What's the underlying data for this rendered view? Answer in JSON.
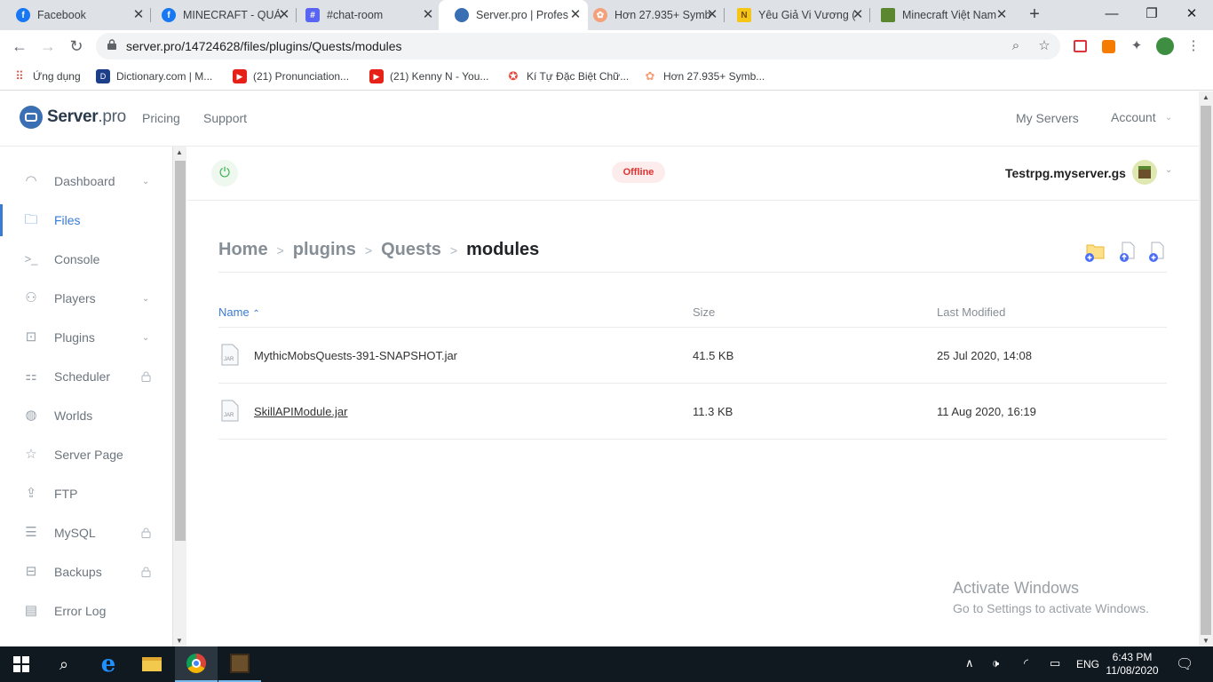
{
  "browser": {
    "tabs": [
      {
        "title": "Facebook",
        "favicon": "facebook-icon",
        "color": "#1877f2",
        "glyph": "f"
      },
      {
        "title": "MINECRAFT - QUẢ",
        "favicon": "facebook-icon",
        "color": "#1877f2",
        "glyph": "f"
      },
      {
        "title": "#chat-room",
        "favicon": "chat-icon",
        "color": "#5865f2",
        "glyph": "#"
      },
      {
        "title": "Server.pro | Profes",
        "favicon": "serverpro-icon",
        "color": "#3a6fb3",
        "glyph": ""
      },
      {
        "title": "Hơn 27.935+ Symb",
        "favicon": "symbol-icon",
        "color": "#f4a07a",
        "glyph": "✿"
      },
      {
        "title": "Yêu Giả Vi Vương (",
        "favicon": "n-icon",
        "color": "#f5c518",
        "glyph": "N"
      },
      {
        "title": "Minecraft Việt Nam",
        "favicon": "minecraft-icon",
        "color": "#5b8731",
        "glyph": ""
      }
    ],
    "url": "server.pro/14724628/files/plugins/Quests/modules",
    "bookmarks": [
      {
        "label": "Ứng dụng",
        "icon": "apps-icon"
      },
      {
        "label": "Dictionary.com | M...",
        "icon": "dictionary-icon"
      },
      {
        "label": "(21) Pronunciation...",
        "icon": "youtube-icon"
      },
      {
        "label": "(21) Kenny N - You...",
        "icon": "youtube-icon"
      },
      {
        "label": "Kí Tự Đặc Biệt Chữ...",
        "icon": "symbol-icon"
      },
      {
        "label": "Hơn 27.935+ Symb...",
        "icon": "symbol-icon"
      }
    ]
  },
  "site": {
    "logo_main": "Server",
    "logo_suffix": ".pro",
    "nav": {
      "pricing": "Pricing",
      "support": "Support",
      "my_servers": "My Servers",
      "account": "Account"
    }
  },
  "sidebar": {
    "items": [
      {
        "label": "Dashboard",
        "icon": "dashboard-icon",
        "chevron": true,
        "locked": false,
        "active": false
      },
      {
        "label": "Files",
        "icon": "folder-icon",
        "chevron": false,
        "locked": false,
        "active": true
      },
      {
        "label": "Console",
        "icon": "terminal-icon",
        "chevron": false,
        "locked": false,
        "active": false
      },
      {
        "label": "Players",
        "icon": "user-icon",
        "chevron": true,
        "locked": false,
        "active": false
      },
      {
        "label": "Plugins",
        "icon": "plugin-icon",
        "chevron": true,
        "locked": false,
        "active": false
      },
      {
        "label": "Scheduler",
        "icon": "scheduler-icon",
        "chevron": false,
        "locked": true,
        "active": false
      },
      {
        "label": "Worlds",
        "icon": "globe-icon",
        "chevron": false,
        "locked": false,
        "active": false
      },
      {
        "label": "Server Page",
        "icon": "star-icon",
        "chevron": false,
        "locked": false,
        "active": false
      },
      {
        "label": "FTP",
        "icon": "upload-icon",
        "chevron": false,
        "locked": false,
        "active": false
      },
      {
        "label": "MySQL",
        "icon": "database-icon",
        "chevron": false,
        "locked": true,
        "active": false
      },
      {
        "label": "Backups",
        "icon": "backup-icon",
        "chevron": false,
        "locked": true,
        "active": false
      },
      {
        "label": "Error Log",
        "icon": "log-icon",
        "chevron": false,
        "locked": false,
        "active": false
      }
    ]
  },
  "server": {
    "status": "Offline",
    "name": "Testrpg.myserver.gs"
  },
  "breadcrumb": [
    "Home",
    "plugins",
    "Quests",
    "modules"
  ],
  "files": {
    "columns": {
      "name": "Name",
      "size": "Size",
      "modified": "Last Modified"
    },
    "rows": [
      {
        "name": "MythicMobsQuests-391-SNAPSHOT.jar",
        "size": "41.5 KB",
        "modified": "25 Jul 2020, 14:08",
        "underlined": false
      },
      {
        "name": "SkillAPIModule.jar",
        "size": "11.3 KB",
        "modified": "11 Aug 2020, 16:19",
        "underlined": true
      }
    ],
    "file_type_label": "JAR"
  },
  "watermark": {
    "line1": "Activate Windows",
    "line2": "Go to Settings to activate Windows."
  },
  "taskbar": {
    "lang": "ENG",
    "time": "6:43 PM",
    "date": "11/08/2020"
  },
  "colors": {
    "accent": "#3a7bd5",
    "offline": "#e03131",
    "power": "#37b24d"
  }
}
